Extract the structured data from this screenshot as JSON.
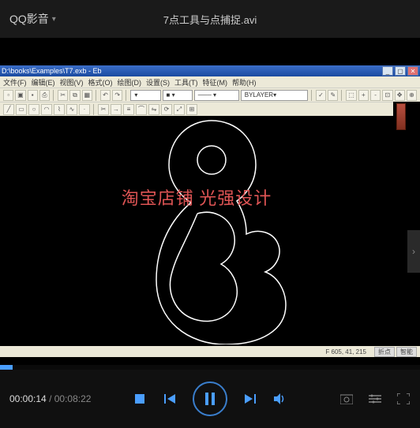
{
  "player": {
    "app_name": "QQ影音",
    "video_title": "7点工具与点捕捉.avi",
    "current_time": "00:00:14",
    "total_time": "00:08:22"
  },
  "cad": {
    "window_title": "D:\\books\\Examples\\T7.exb - Eb",
    "menu": [
      "文件(F)",
      "编辑(E)",
      "视图(V)",
      "格式(O)",
      "绘图(D)",
      "设置(S)",
      "工具(T)",
      "特征(M)",
      "帮助(H)"
    ],
    "layer_combo": "BYLAYER",
    "watermark": "淘宝店铺  光强设计",
    "coords": "F 605, 41, 215",
    "status_btn1": "折点",
    "status_btn2": "智能"
  }
}
